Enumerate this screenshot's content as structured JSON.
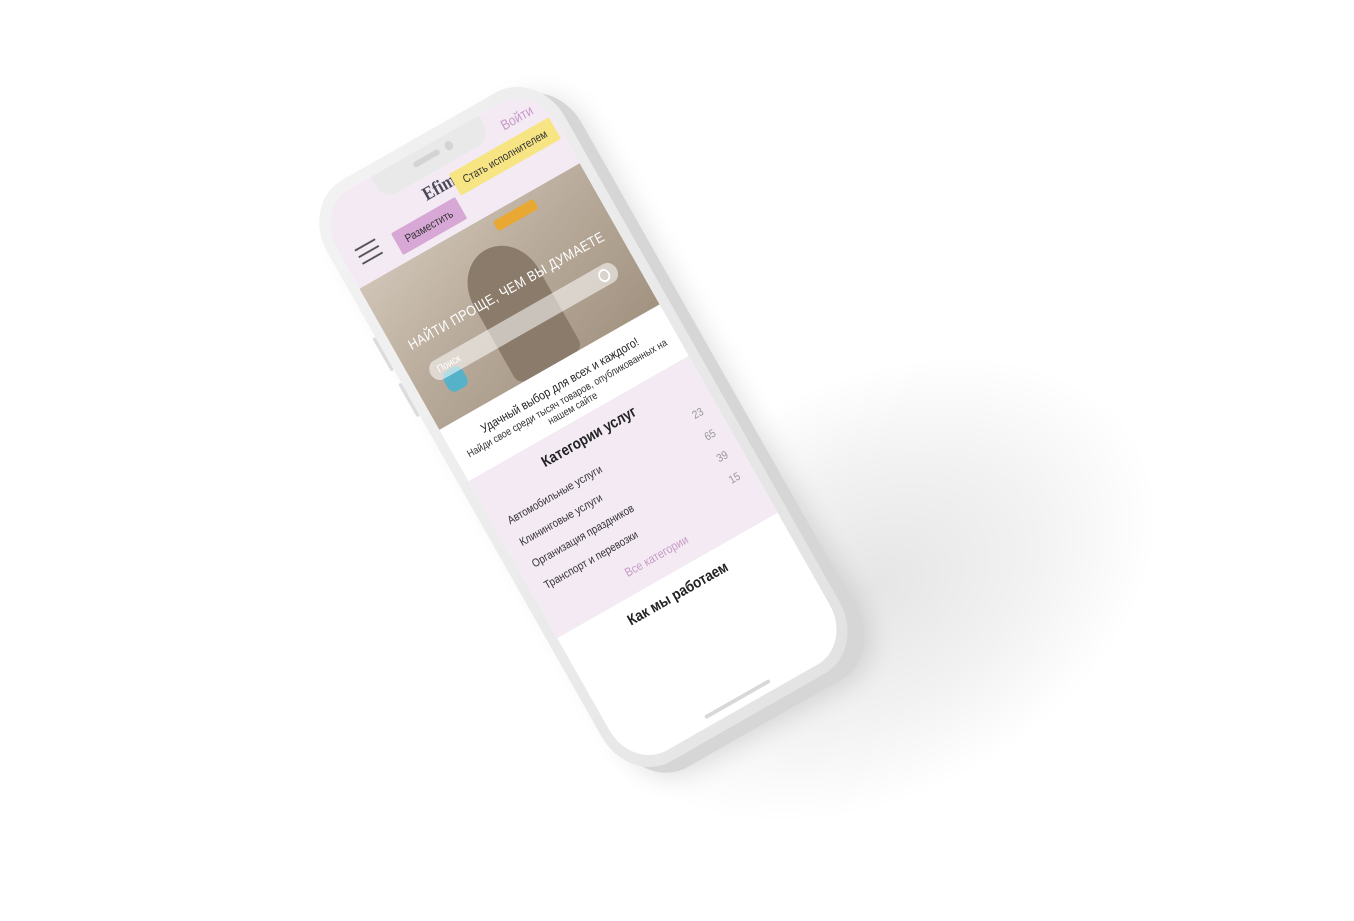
{
  "header": {
    "login_label": "Войти",
    "logo_text": "Efima",
    "place_button": "Разместить",
    "become_performer_button": "Стать исполнителем"
  },
  "hero": {
    "title": "НАЙТИ ПРОЩЕ, ЧЕМ ВЫ ДУМАЕТЕ",
    "search_placeholder": "Поиск"
  },
  "tagline": {
    "line1": "Удачный выбор для всех и каждого!",
    "line2": "Найди свое среди тысяч товаров, опубликованных на нашем сайте"
  },
  "categories": {
    "title": "Категории услуг",
    "items": [
      {
        "label": "Автомобильные услуги",
        "count": "23"
      },
      {
        "label": "Клининговые услуги",
        "count": "65"
      },
      {
        "label": "Организация праздников",
        "count": "39"
      },
      {
        "label": "Транспорт и перевозки",
        "count": "15"
      }
    ],
    "all_label": "Все категории"
  },
  "how": {
    "title": "Как мы работаем"
  },
  "colors": {
    "header_bg": "#f3eaf3",
    "accent_pink": "#d7a7d6",
    "accent_yellow": "#f7e584",
    "link_pink": "#c79ac8"
  }
}
